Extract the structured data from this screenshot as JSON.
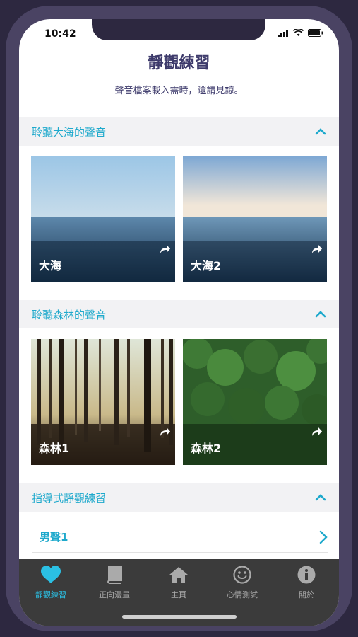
{
  "status_bar": {
    "time": "10:42"
  },
  "header": {
    "title": "靜觀練習",
    "subtitle": "聲音檔案載入需時，還請見諒。"
  },
  "sections": [
    {
      "title": "聆聽大海的聲音",
      "cards": [
        {
          "label": "大海",
          "icon": "share-icon"
        },
        {
          "label": "大海2",
          "icon": "share-icon"
        }
      ]
    },
    {
      "title": "聆聽森林的聲音",
      "cards": [
        {
          "label": "森林1",
          "icon": "share-icon"
        },
        {
          "label": "森林2",
          "icon": "share-icon"
        }
      ]
    },
    {
      "title": "指導式靜觀練習",
      "items": [
        {
          "label": "男聲1"
        }
      ]
    }
  ],
  "tabbar": {
    "active_color": "#2bc0e4",
    "tabs": [
      {
        "label": "靜觀練習",
        "icon": "heart-icon",
        "active": true
      },
      {
        "label": "正向漫畫",
        "icon": "book-icon",
        "active": false
      },
      {
        "label": "主頁",
        "icon": "home-icon",
        "active": false
      },
      {
        "label": "心情測試",
        "icon": "smile-icon",
        "active": false
      },
      {
        "label": "關於",
        "icon": "info-icon",
        "active": false
      }
    ]
  },
  "colors": {
    "accent": "#1ea9cc",
    "title": "#3d3a6b",
    "tabbar_bg": "#3b3b3b"
  }
}
